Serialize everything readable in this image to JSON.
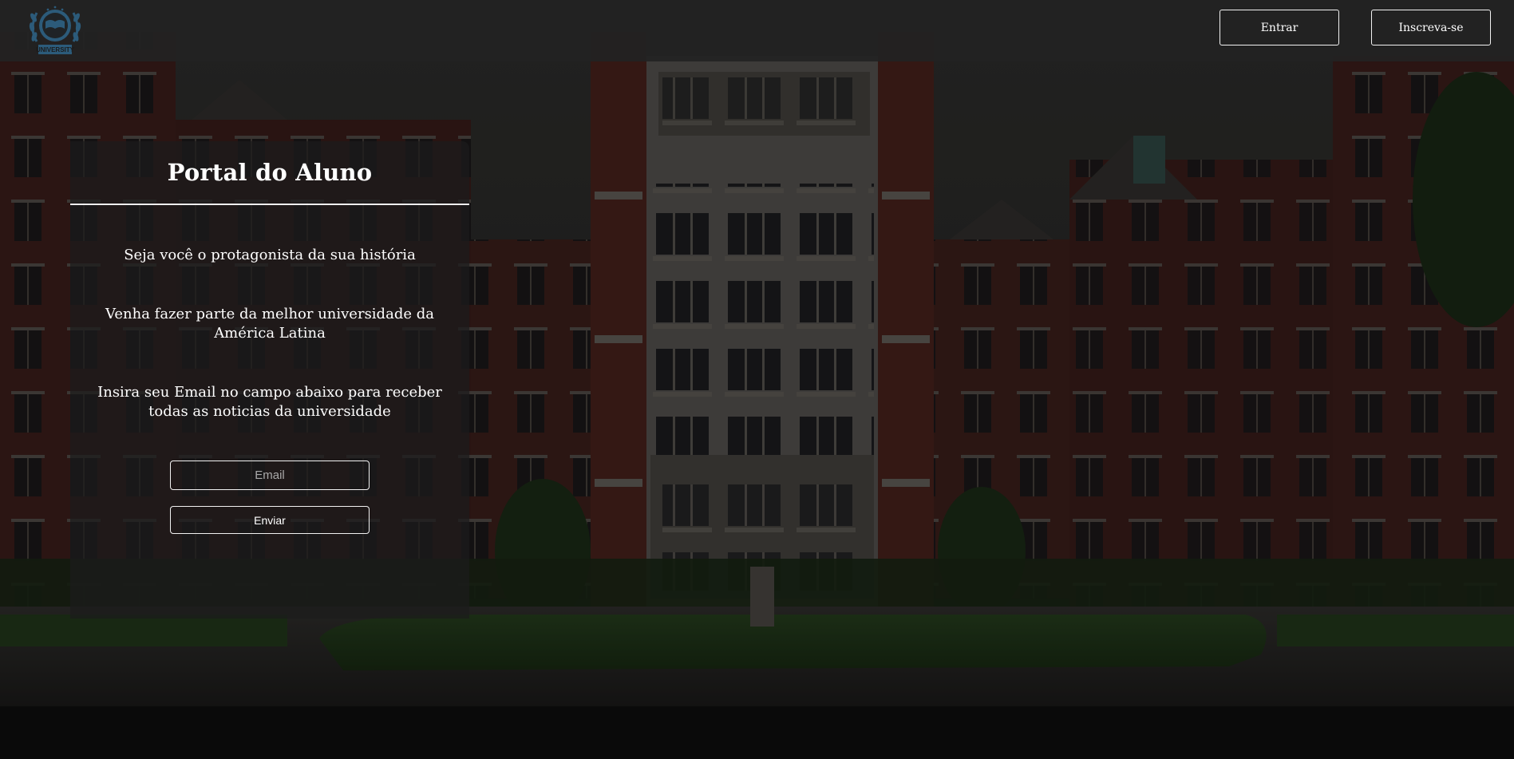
{
  "header": {
    "logo_text": "UNIVERSITY",
    "login_label": "Entrar",
    "signup_label": "Inscreva-se"
  },
  "portal": {
    "title": "Portal do Aluno",
    "tagline": "Seja você o protagonista da sua história",
    "pitch": "Venha fazer parte da melhor universidade da América Latina",
    "instructions": "Insira seu Email no campo abaixo para receber todas as noticias da universidade",
    "email_placeholder": "Email",
    "submit_label": "Enviar"
  },
  "colors": {
    "topbar": "#222222",
    "card_background": "#1c1c1c",
    "text": "#ffffff",
    "border": "#f2f2f2",
    "logo": "#2c5b7a",
    "brick": "#4a2420",
    "stone": "#4d4a46",
    "lawn": "#2b4a22"
  }
}
